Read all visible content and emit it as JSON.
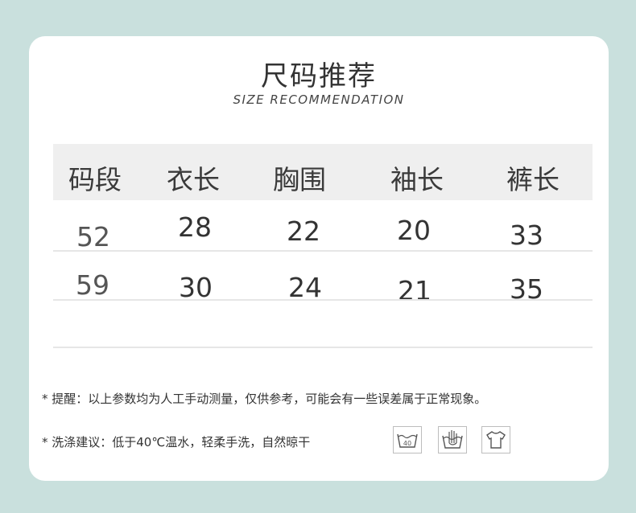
{
  "heading": {
    "title": "尺码推荐",
    "subtitle": "SIZE RECOMMENDATION"
  },
  "size_table": {
    "headers": [
      "码段",
      "衣长",
      "胸围",
      "袖长",
      "裤长"
    ],
    "rows": [
      [
        "52",
        "28",
        "22",
        "20",
        "33"
      ],
      [
        "59",
        "30",
        "24",
        "21",
        "35"
      ]
    ]
  },
  "notes": {
    "tip": "* 提醒：以上参数均为人工手动测量，仅供参考，可能会有一些误差属于正常现象。",
    "washing": "* 洗涤建议：低于40℃温水，轻柔手洗，自然晾干"
  },
  "care_icons": {
    "items": [
      "wash-40-icon",
      "hand-wash-icon",
      "shirt-icon"
    ],
    "wash_temp": "40"
  }
}
